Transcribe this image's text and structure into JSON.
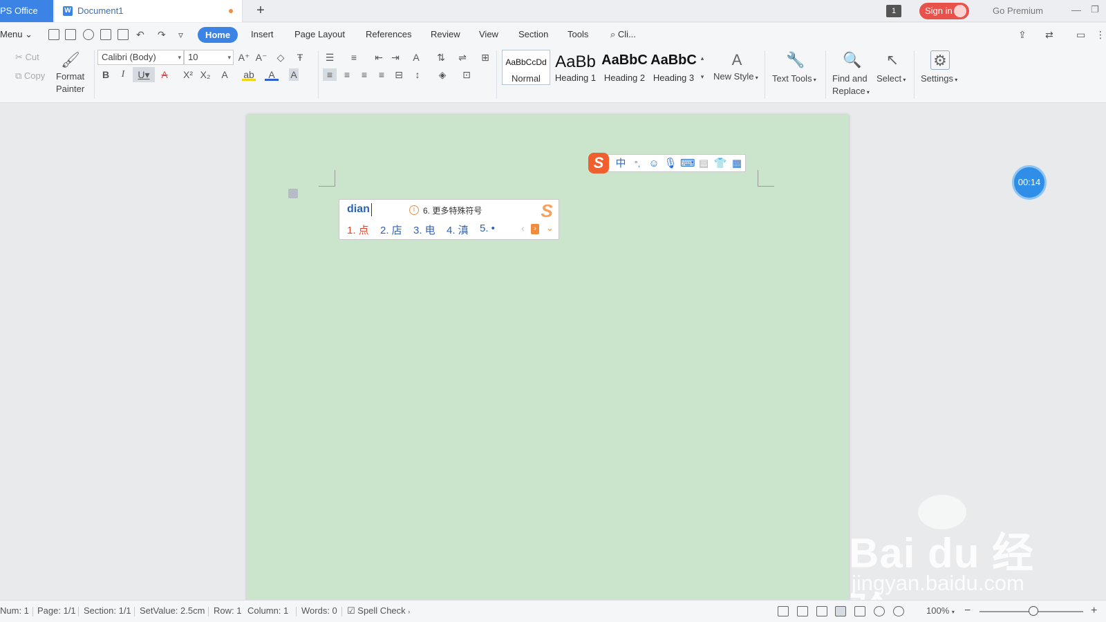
{
  "titlebar": {
    "app_tab": "PS Office",
    "doc_tab": "Document1",
    "doc_icon": "W",
    "new_tab": "+",
    "window_count": "1",
    "sign_in": "Sign in",
    "premium": "Go Premium"
  },
  "menubar": {
    "menu": "Menu",
    "tabs": [
      "Home",
      "Insert",
      "Page Layout",
      "References",
      "Review",
      "View",
      "Section",
      "Tools"
    ],
    "search": "Cli..."
  },
  "ribbon": {
    "cut": "Cut",
    "copy": "Copy",
    "format_painter_line1": "Format",
    "format_painter_line2": "Painter",
    "font_name": "Calibri (Body)",
    "font_size": "10",
    "styles": [
      {
        "sample": "AaBbCcDd",
        "name": "Normal"
      },
      {
        "sample": "AaBb",
        "name": "Heading 1"
      },
      {
        "sample": "AaBbC",
        "name": "Heading 2"
      },
      {
        "sample": "AaBbC",
        "name": "Heading 3"
      }
    ],
    "new_style": "New Style",
    "text_tools": "Text Tools",
    "find_line1": "Find and",
    "find_line2": "Replace",
    "select": "Select",
    "settings": "Settings"
  },
  "ime_toolbar": {
    "logo": "S",
    "mode": "中",
    "punct": "°,"
  },
  "ime_candidates": {
    "input": "dian",
    "hint": "6. 更多特殊符号",
    "items": [
      "1. 点",
      "2. 店",
      "3. 电",
      "4. 滇",
      "5. •"
    ]
  },
  "timer": "00:14",
  "watermark": {
    "brand": "Bai du 经验",
    "url": "jingyan.baidu.com"
  },
  "statusbar": {
    "num": "Num: 1",
    "page": "Page: 1/1",
    "section": "Section: 1/1",
    "setvalue": "SetValue: 2.5cm",
    "row": "Row: 1",
    "column": "Column: 1",
    "words": "Words: 0",
    "spell": "Spell Check",
    "zoom": "100%"
  },
  "colors": {
    "accent": "#3c83e6",
    "signin": "#e9514b",
    "page_bg": "#cae5cc",
    "ime_orange": "#f0602f"
  }
}
